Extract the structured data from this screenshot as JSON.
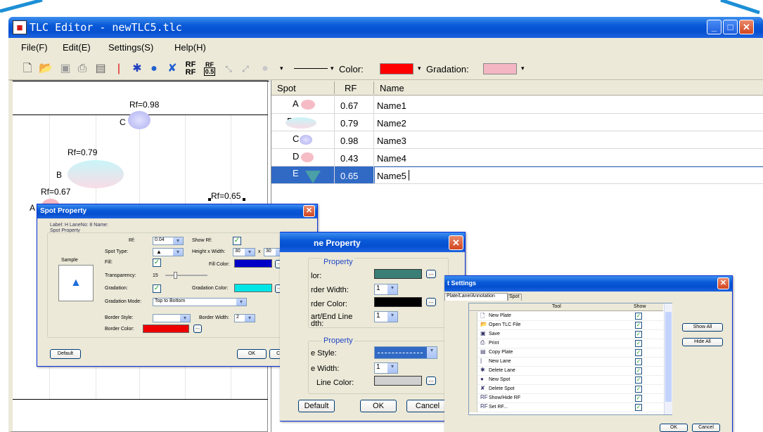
{
  "window": {
    "title": "TLC Editor - newTLC5.tlc"
  },
  "menu": [
    "File(F)",
    "Edit(E)",
    "Settings(S)",
    "Help(H)"
  ],
  "toolbar": {
    "color_label": "Color:",
    "gradation_label": "Gradation:",
    "rf_label": "RF",
    "rf_sub": "0.5"
  },
  "colors": {
    "accent": "#0a5ad8",
    "spot_red": "#ff0000",
    "gradation_pink": "#f4b6c2",
    "selected_row": "#316ac5"
  },
  "plate": {
    "labels": [
      {
        "text": "Rf=0.98",
        "spot": "C"
      },
      {
        "text": "Rf=0.79",
        "spot": "B"
      },
      {
        "text": "Rf=0.67",
        "spot": "A"
      },
      {
        "text": "Rf=0.65",
        "spot": "E"
      }
    ],
    "spot_letters": {
      "c": "C",
      "b": "B",
      "a": "A"
    }
  },
  "table": {
    "headers": [
      "Spot",
      "RF",
      "Name"
    ],
    "rows": [
      {
        "spot": "A",
        "rf": "0.67",
        "name": "Name1"
      },
      {
        "spot": "B",
        "rf": "0.79",
        "name": "Name2"
      },
      {
        "spot": "C",
        "rf": "0.98",
        "name": "Name3"
      },
      {
        "spot": "D",
        "rf": "0.43",
        "name": "Name4"
      },
      {
        "spot": "E",
        "rf": "0.65",
        "name": "Name5"
      }
    ],
    "selected_index": 4
  },
  "spot_dialog": {
    "title": "Spot Property",
    "header": "Label: H  LaneNo: 8   Name:",
    "group": "Spot Property",
    "sample": "Sample",
    "rf_label": "Rf:",
    "rf_value": "0.04",
    "spot_type_label": "Spot Type:",
    "fill_label": "Fill:",
    "transparency_label": "Transparency:",
    "transparency_value": "15",
    "gradation_label": "Gradation:",
    "gradation_mode_label": "Gradation Mode:",
    "gradation_mode_value": "Top to Bottom",
    "border_style_label": "Border Style:",
    "border_color_label": "Border Color:",
    "show_rf_label": "Show Rf:",
    "hw_label": "Height x Width:",
    "h_value": "30",
    "x": "x",
    "w_value": "30",
    "fill_color_label": "Fill Color:",
    "gradation_color_label": "Gradation Color:",
    "border_width_label": "Border Width:",
    "border_width_value": "2",
    "default_btn": "Default",
    "ok_btn": "OK",
    "cancel_btn": "Cancel",
    "fill_color": "#0000c8",
    "gradation_color": "#00e5e5",
    "border_color": "#ee0000"
  },
  "lane_dialog": {
    "title": "ne Property",
    "group1": "Property",
    "color_label": "lor:",
    "border_width_label": "rder Width:",
    "border_width_value": "1",
    "border_color_label": "rder Color:",
    "start_end_label": "art/End Line",
    "start_end_label2": "dth:",
    "start_end_value": "1",
    "group2": "Property",
    "line_style_label": "e Style:",
    "line_width_label": "e Width:",
    "line_width_value": "1",
    "line_color_label": "Line Color:",
    "default_btn": "Default",
    "ok_btn": "OK",
    "cancel_btn": "Cancel",
    "color": "#3a7f76",
    "border_color": "#000000",
    "line_color": "#d0d0d0"
  },
  "tool_dialog": {
    "title": "t Settings",
    "tabs": [
      "Plate/Lane/Annotation",
      "Spot"
    ],
    "headers": [
      "Tool",
      "Show"
    ],
    "rows": [
      "New Plate",
      "Open TLC File",
      "Save",
      "Print",
      "Copy Plate",
      "New Lane",
      "Delete Lane",
      "New Spot",
      "Delete Spot",
      "Show/Hide RF",
      "Set RF..."
    ],
    "show_all": "Show All",
    "hide_all": "Hide All",
    "ok_btn": "OK",
    "cancel_btn": "Cancel"
  }
}
